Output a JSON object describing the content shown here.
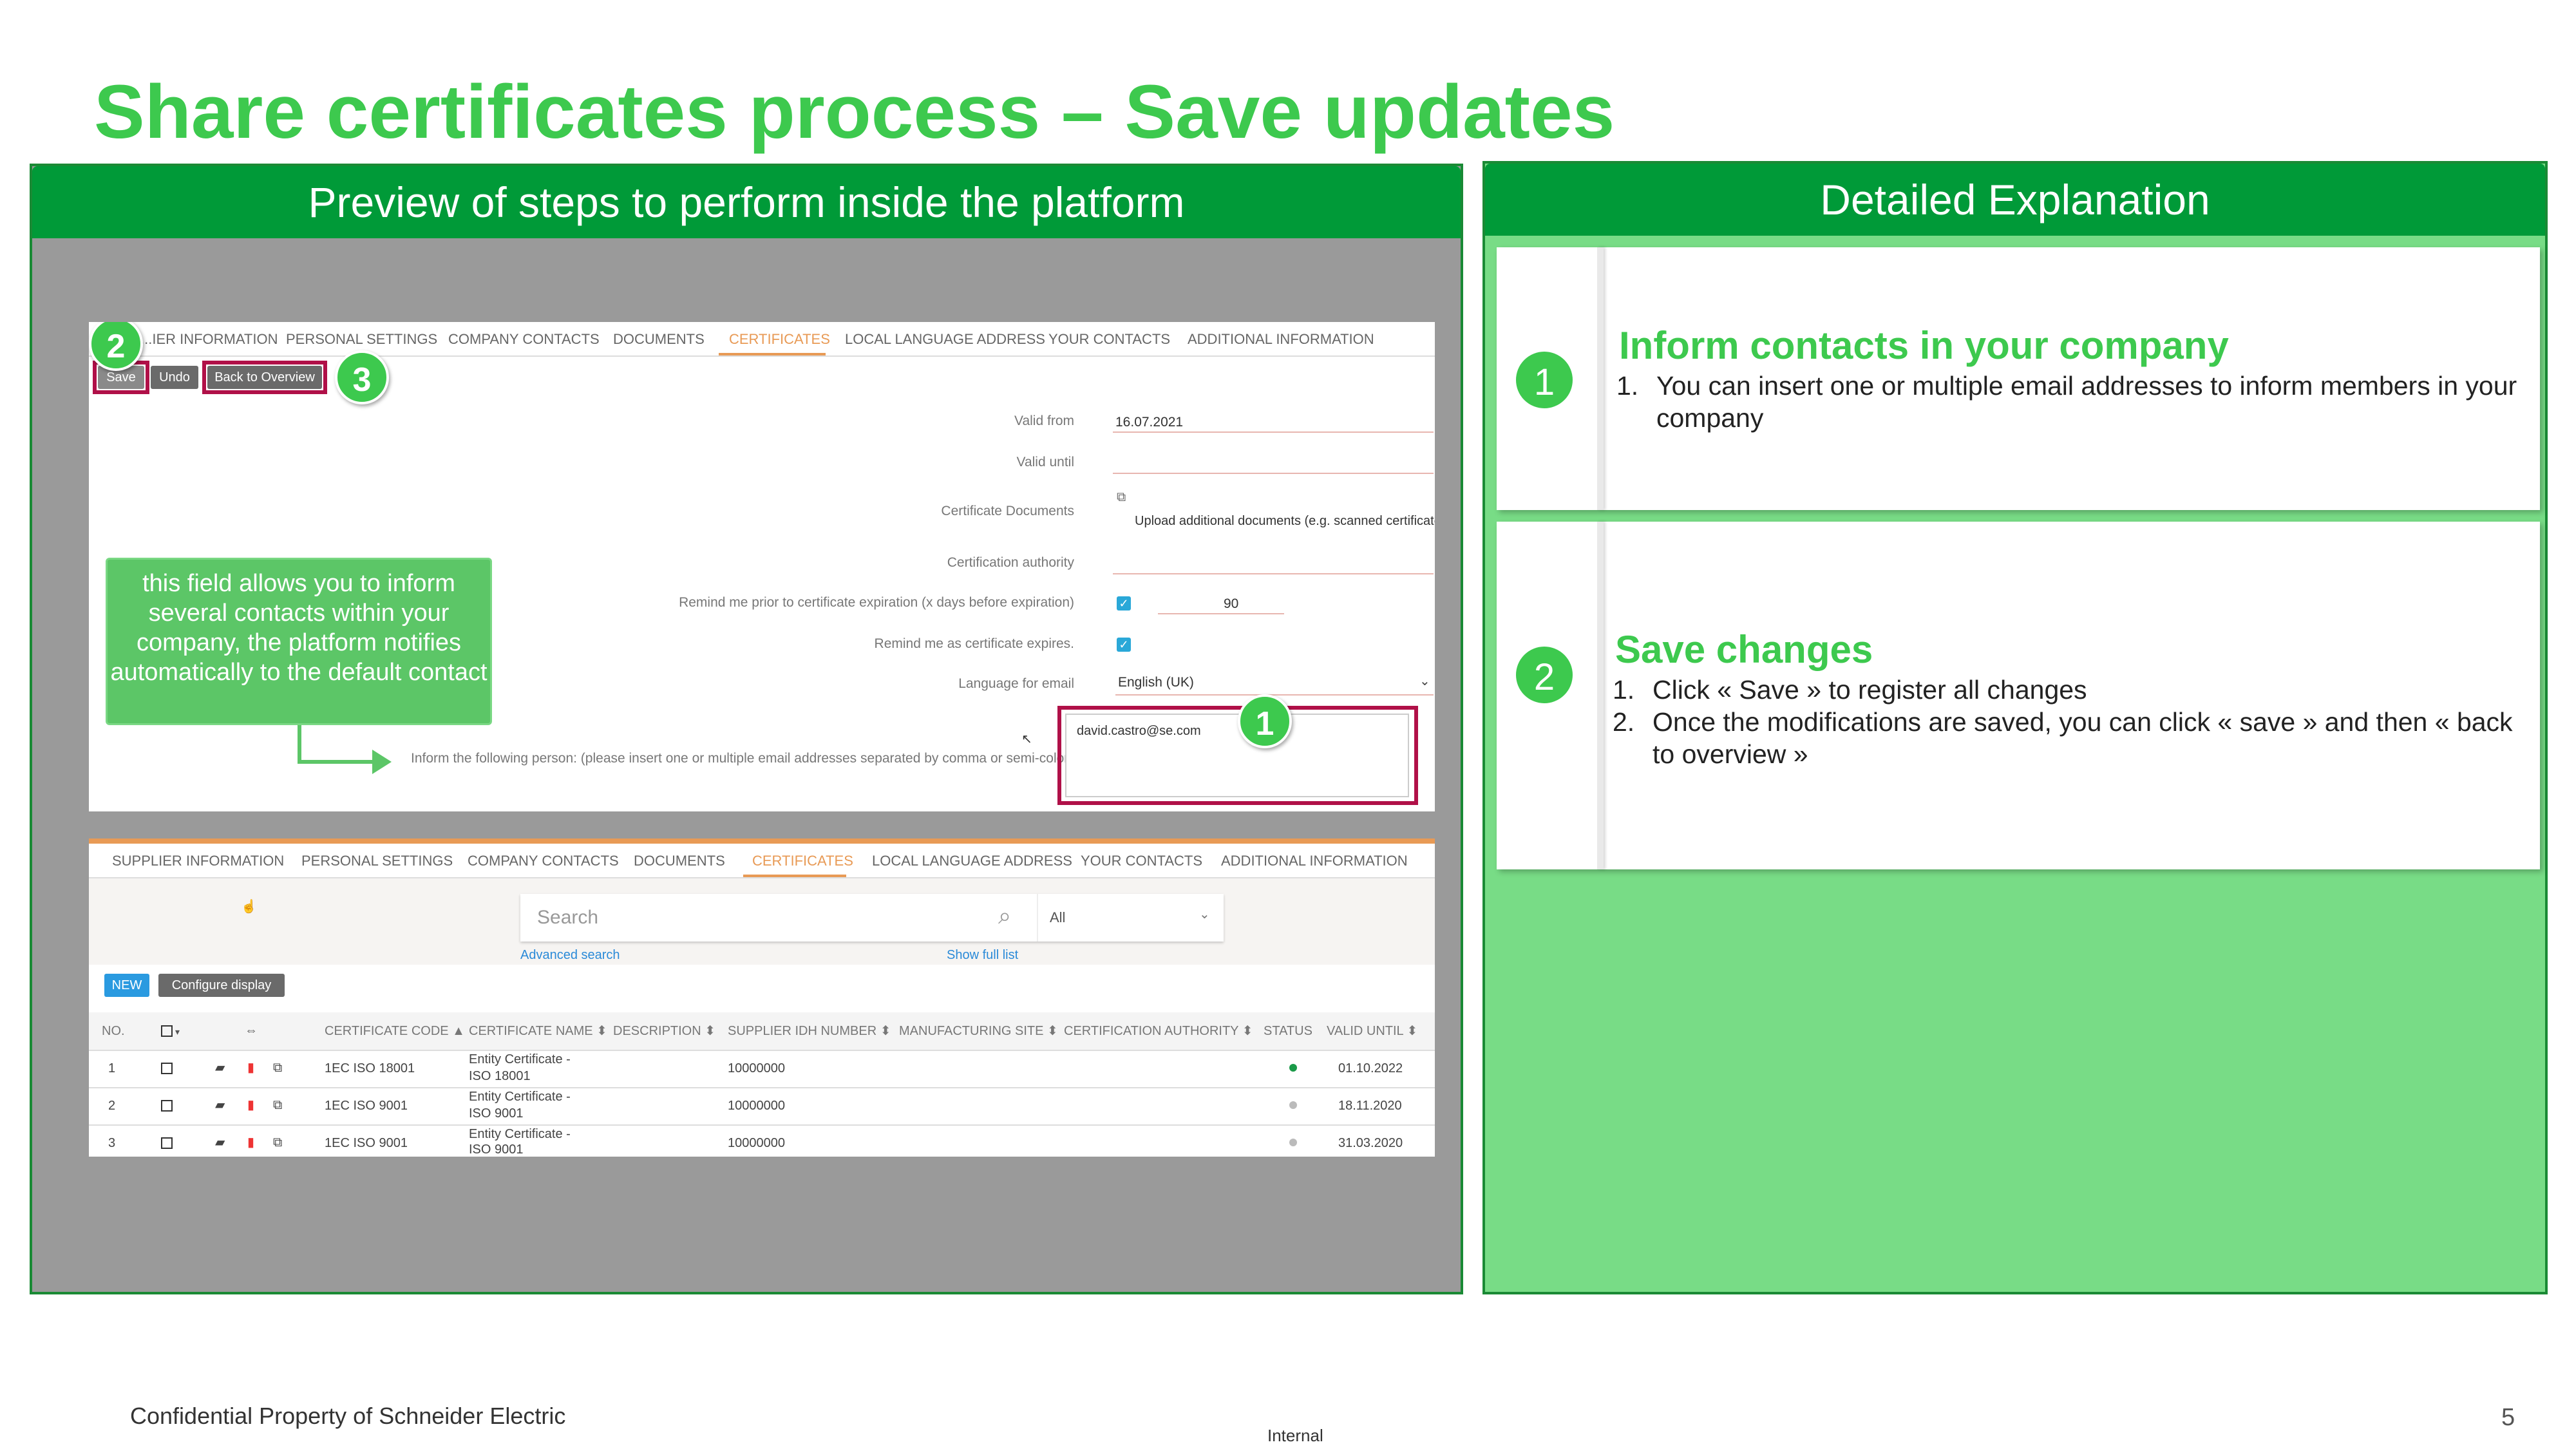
{
  "slide": {
    "title": "Share certificates process – Save updates",
    "footer_left": "Confidential Property of Schneider Electric",
    "footer_center": "Internal",
    "page_number": "5"
  },
  "left_panel": {
    "header": "Preview of  steps to perform inside the platform"
  },
  "right_panel": {
    "header": "Detailed Explanation",
    "cards": [
      {
        "number": "1",
        "title": "Inform contacts in your company",
        "items": [
          "You can insert one or multiple email addresses to inform members in your company"
        ]
      },
      {
        "number": "2",
        "title": "Save changes",
        "items": [
          "Click « Save » to register all changes",
          "Once the modifications are saved, you can click « save » and then « back to overview »"
        ]
      }
    ]
  },
  "screen1": {
    "tabs": [
      "...IER INFORMATION",
      "PERSONAL SETTINGS",
      "COMPANY CONTACTS",
      "DOCUMENTS",
      "CERTIFICATES",
      "LOCAL LANGUAGE ADDRESS",
      "YOUR CONTACTS",
      "ADDITIONAL INFORMATION"
    ],
    "buttons": {
      "save": "Save",
      "undo": "Undo",
      "back": "Back to Overview"
    },
    "fields": {
      "valid_from_label": "Valid from",
      "valid_from_value": "16.07.2021",
      "valid_until_label": "Valid until",
      "cert_docs_label": "Certificate Documents",
      "cert_docs_hint": "Upload additional documents (e.g. scanned certificate).",
      "authority_label": "Certification authority",
      "remind_prior_label": "Remind me prior to certificate expiration (x days before expiration)",
      "remind_prior_value": "90",
      "remind_expire_label": "Remind me as certificate expires.",
      "language_label": "Language for email",
      "language_value": "English (UK)",
      "inform_label": "Inform the following person: (please insert one or multiple email addresses separated by comma or semi-colon)",
      "inform_value": "david.castro@se.com"
    },
    "callout": "this field allows you to inform several contacts within your company, the platform notifies automatically to the default contact",
    "markers": {
      "m1": "1",
      "m2": "2",
      "m3": "3"
    }
  },
  "screen2": {
    "tabs": [
      "SUPPLIER INFORMATION",
      "PERSONAL SETTINGS",
      "COMPANY CONTACTS",
      "DOCUMENTS",
      "CERTIFICATES",
      "LOCAL LANGUAGE ADDRESS",
      "YOUR CONTACTS",
      "ADDITIONAL INFORMATION"
    ],
    "search_placeholder": "Search",
    "filter_value": "All",
    "advanced_search": "Advanced search",
    "show_full_list": "Show full list",
    "new_button": "NEW",
    "configure_button": "Configure display",
    "columns": [
      "NO.",
      "CERTIFICATE CODE ▲",
      "CERTIFICATE NAME ⬍",
      "DESCRIPTION ⬍",
      "SUPPLIER IDH NUMBER ⬍",
      "MANUFACTURING SITE ⬍",
      "CERTIFICATION AUTHORITY ⬍",
      "STATUS",
      "VALID UNTIL ⬍"
    ],
    "rows": [
      {
        "no": "1",
        "code": "1EC ISO 18001",
        "name1": "Entity Certificate -",
        "name2": "ISO 18001",
        "idh": "10000000",
        "status": "active",
        "valid": "01.10.2022"
      },
      {
        "no": "2",
        "code": "1EC ISO 9001",
        "name1": "Entity Certificate -",
        "name2": "ISO 9001",
        "idh": "10000000",
        "status": "inactive",
        "valid": "18.11.2020"
      },
      {
        "no": "3",
        "code": "1EC ISO 9001",
        "name1": "Entity Certificate -",
        "name2": "ISO 9001",
        "idh": "10000000",
        "status": "inactive",
        "valid": "31.03.2020"
      }
    ]
  },
  "colors": {
    "brand_green": "#009a38",
    "accent_green": "#3dc94e",
    "panel_green": "#78dc86",
    "highlight_red": "#b01048",
    "tab_active": "#e89a55"
  }
}
